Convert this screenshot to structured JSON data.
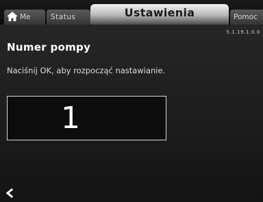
{
  "tabs": [
    {
      "id": "home",
      "label": "Me",
      "icon": "home-icon",
      "active": false
    },
    {
      "id": "status",
      "label": "Status",
      "active": false
    },
    {
      "id": "settings",
      "label": "Ustawienia",
      "active": true
    },
    {
      "id": "assist",
      "label": "Pomoc",
      "active": false
    }
  ],
  "menu_path": "5.1.19.1.0.0",
  "page_title": "Numer pompy",
  "instruction": "Naciśnij OK, aby rozpocząć nastawianie.",
  "pump_number_value": "1",
  "back_icon": "chevron-left-icon",
  "colors": {
    "background": "#262626",
    "active_tab": "#d9d9d9",
    "text": "#ffffff"
  }
}
